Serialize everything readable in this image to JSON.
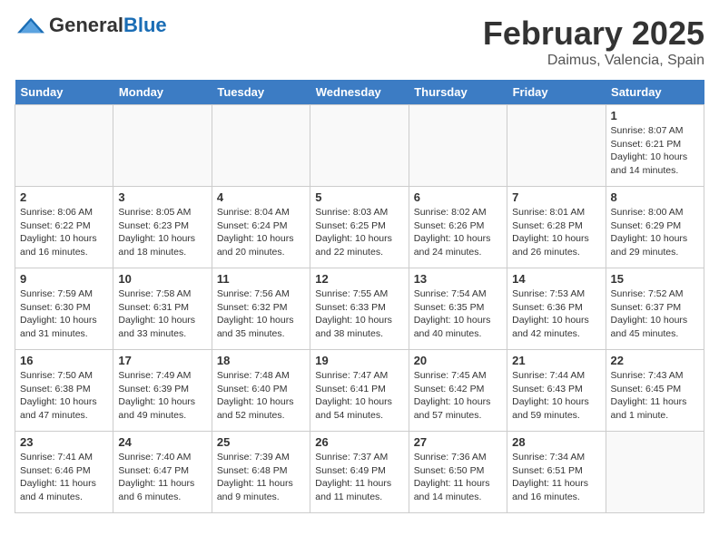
{
  "logo": {
    "general": "General",
    "blue": "Blue"
  },
  "header": {
    "month": "February 2025",
    "location": "Daimus, Valencia, Spain"
  },
  "weekdays": [
    "Sunday",
    "Monday",
    "Tuesday",
    "Wednesday",
    "Thursday",
    "Friday",
    "Saturday"
  ],
  "weeks": [
    [
      {
        "day": "",
        "info": ""
      },
      {
        "day": "",
        "info": ""
      },
      {
        "day": "",
        "info": ""
      },
      {
        "day": "",
        "info": ""
      },
      {
        "day": "",
        "info": ""
      },
      {
        "day": "",
        "info": ""
      },
      {
        "day": "1",
        "info": "Sunrise: 8:07 AM\nSunset: 6:21 PM\nDaylight: 10 hours and 14 minutes."
      }
    ],
    [
      {
        "day": "2",
        "info": "Sunrise: 8:06 AM\nSunset: 6:22 PM\nDaylight: 10 hours and 16 minutes."
      },
      {
        "day": "3",
        "info": "Sunrise: 8:05 AM\nSunset: 6:23 PM\nDaylight: 10 hours and 18 minutes."
      },
      {
        "day": "4",
        "info": "Sunrise: 8:04 AM\nSunset: 6:24 PM\nDaylight: 10 hours and 20 minutes."
      },
      {
        "day": "5",
        "info": "Sunrise: 8:03 AM\nSunset: 6:25 PM\nDaylight: 10 hours and 22 minutes."
      },
      {
        "day": "6",
        "info": "Sunrise: 8:02 AM\nSunset: 6:26 PM\nDaylight: 10 hours and 24 minutes."
      },
      {
        "day": "7",
        "info": "Sunrise: 8:01 AM\nSunset: 6:28 PM\nDaylight: 10 hours and 26 minutes."
      },
      {
        "day": "8",
        "info": "Sunrise: 8:00 AM\nSunset: 6:29 PM\nDaylight: 10 hours and 29 minutes."
      }
    ],
    [
      {
        "day": "9",
        "info": "Sunrise: 7:59 AM\nSunset: 6:30 PM\nDaylight: 10 hours and 31 minutes."
      },
      {
        "day": "10",
        "info": "Sunrise: 7:58 AM\nSunset: 6:31 PM\nDaylight: 10 hours and 33 minutes."
      },
      {
        "day": "11",
        "info": "Sunrise: 7:56 AM\nSunset: 6:32 PM\nDaylight: 10 hours and 35 minutes."
      },
      {
        "day": "12",
        "info": "Sunrise: 7:55 AM\nSunset: 6:33 PM\nDaylight: 10 hours and 38 minutes."
      },
      {
        "day": "13",
        "info": "Sunrise: 7:54 AM\nSunset: 6:35 PM\nDaylight: 10 hours and 40 minutes."
      },
      {
        "day": "14",
        "info": "Sunrise: 7:53 AM\nSunset: 6:36 PM\nDaylight: 10 hours and 42 minutes."
      },
      {
        "day": "15",
        "info": "Sunrise: 7:52 AM\nSunset: 6:37 PM\nDaylight: 10 hours and 45 minutes."
      }
    ],
    [
      {
        "day": "16",
        "info": "Sunrise: 7:50 AM\nSunset: 6:38 PM\nDaylight: 10 hours and 47 minutes."
      },
      {
        "day": "17",
        "info": "Sunrise: 7:49 AM\nSunset: 6:39 PM\nDaylight: 10 hours and 49 minutes."
      },
      {
        "day": "18",
        "info": "Sunrise: 7:48 AM\nSunset: 6:40 PM\nDaylight: 10 hours and 52 minutes."
      },
      {
        "day": "19",
        "info": "Sunrise: 7:47 AM\nSunset: 6:41 PM\nDaylight: 10 hours and 54 minutes."
      },
      {
        "day": "20",
        "info": "Sunrise: 7:45 AM\nSunset: 6:42 PM\nDaylight: 10 hours and 57 minutes."
      },
      {
        "day": "21",
        "info": "Sunrise: 7:44 AM\nSunset: 6:43 PM\nDaylight: 10 hours and 59 minutes."
      },
      {
        "day": "22",
        "info": "Sunrise: 7:43 AM\nSunset: 6:45 PM\nDaylight: 11 hours and 1 minute."
      }
    ],
    [
      {
        "day": "23",
        "info": "Sunrise: 7:41 AM\nSunset: 6:46 PM\nDaylight: 11 hours and 4 minutes."
      },
      {
        "day": "24",
        "info": "Sunrise: 7:40 AM\nSunset: 6:47 PM\nDaylight: 11 hours and 6 minutes."
      },
      {
        "day": "25",
        "info": "Sunrise: 7:39 AM\nSunset: 6:48 PM\nDaylight: 11 hours and 9 minutes."
      },
      {
        "day": "26",
        "info": "Sunrise: 7:37 AM\nSunset: 6:49 PM\nDaylight: 11 hours and 11 minutes."
      },
      {
        "day": "27",
        "info": "Sunrise: 7:36 AM\nSunset: 6:50 PM\nDaylight: 11 hours and 14 minutes."
      },
      {
        "day": "28",
        "info": "Sunrise: 7:34 AM\nSunset: 6:51 PM\nDaylight: 11 hours and 16 minutes."
      },
      {
        "day": "",
        "info": ""
      }
    ]
  ]
}
